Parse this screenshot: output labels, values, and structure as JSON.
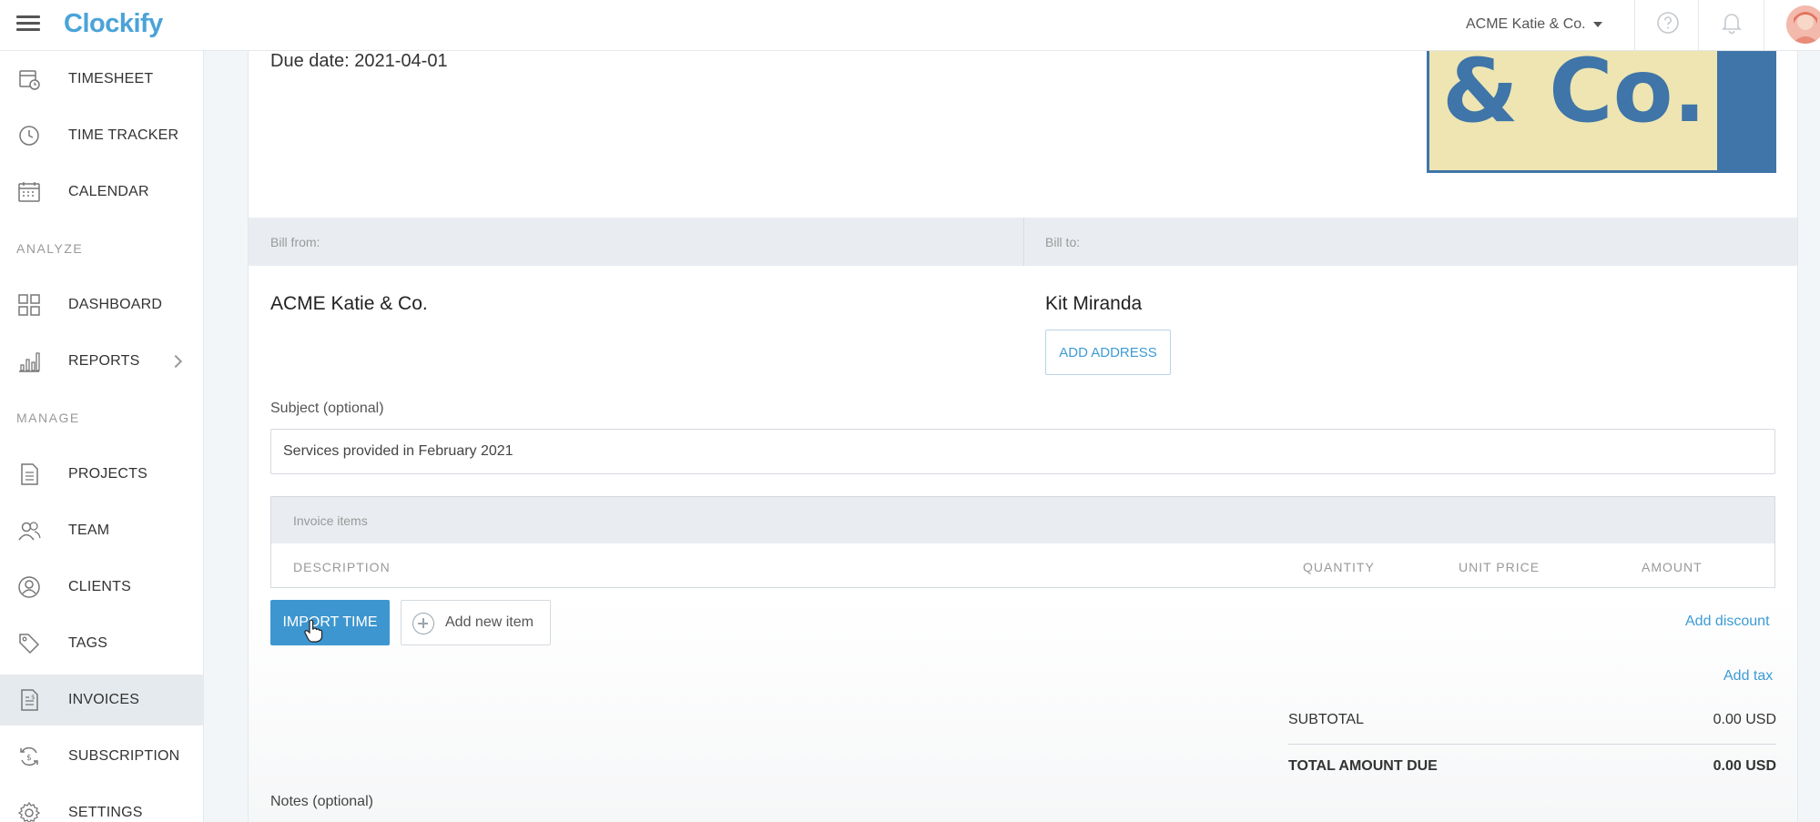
{
  "header": {
    "brand": "Clockify",
    "workspace": "ACME Katie & Co.",
    "icons": [
      "menu-icon",
      "help-icon",
      "bell-icon",
      "avatar"
    ]
  },
  "sidebar": {
    "items": [
      {
        "label": "TIMESHEET",
        "icon": "timesheet-icon"
      },
      {
        "label": "TIME TRACKER",
        "icon": "clock-icon"
      },
      {
        "label": "CALENDAR",
        "icon": "calendar-icon"
      },
      {
        "label": "DASHBOARD",
        "icon": "dashboard-icon"
      },
      {
        "label": "REPORTS",
        "icon": "reports-icon"
      },
      {
        "label": "PROJECTS",
        "icon": "document-icon"
      },
      {
        "label": "TEAM",
        "icon": "team-icon"
      },
      {
        "label": "CLIENTS",
        "icon": "client-icon"
      },
      {
        "label": "TAGS",
        "icon": "tag-icon"
      },
      {
        "label": "INVOICES",
        "icon": "invoice-icon",
        "active": true
      },
      {
        "label": "SUBSCRIPTION",
        "icon": "subscription-icon"
      },
      {
        "label": "SETTINGS",
        "icon": "gear-icon"
      }
    ],
    "sections": {
      "analyze": "ANALYZE",
      "manage": "MANAGE"
    }
  },
  "invoice": {
    "due_date": "Due date: 2021-04-01",
    "logo_text": "& Co.",
    "bill_from_label": "Bill from:",
    "bill_to_label": "Bill to:",
    "company": "ACME Katie & Co.",
    "client": "Kit Miranda",
    "add_address": "ADD ADDRESS",
    "subject_label": "Subject (optional)",
    "subject_value": "Services provided in February 2021",
    "items_title": "Invoice items",
    "columns": {
      "description": "DESCRIPTION",
      "quantity": "QUANTITY",
      "unit_price": "UNIT PRICE",
      "amount": "AMOUNT"
    },
    "import_time": "IMPORT TIME",
    "add_new_item": "Add new item",
    "add_discount": "Add discount",
    "add_tax": "Add tax",
    "subtotal_label": "SUBTOTAL",
    "subtotal_value": "0.00 USD",
    "total_label": "TOTAL AMOUNT DUE",
    "total_value": "0.00 USD",
    "notes_label": "Notes (optional)"
  },
  "colors": {
    "accent": "#3d96cf",
    "brand_blue": "#3f75a8",
    "logo_bg": "#eee5b2",
    "active_item_bg": "#e5eaee"
  }
}
